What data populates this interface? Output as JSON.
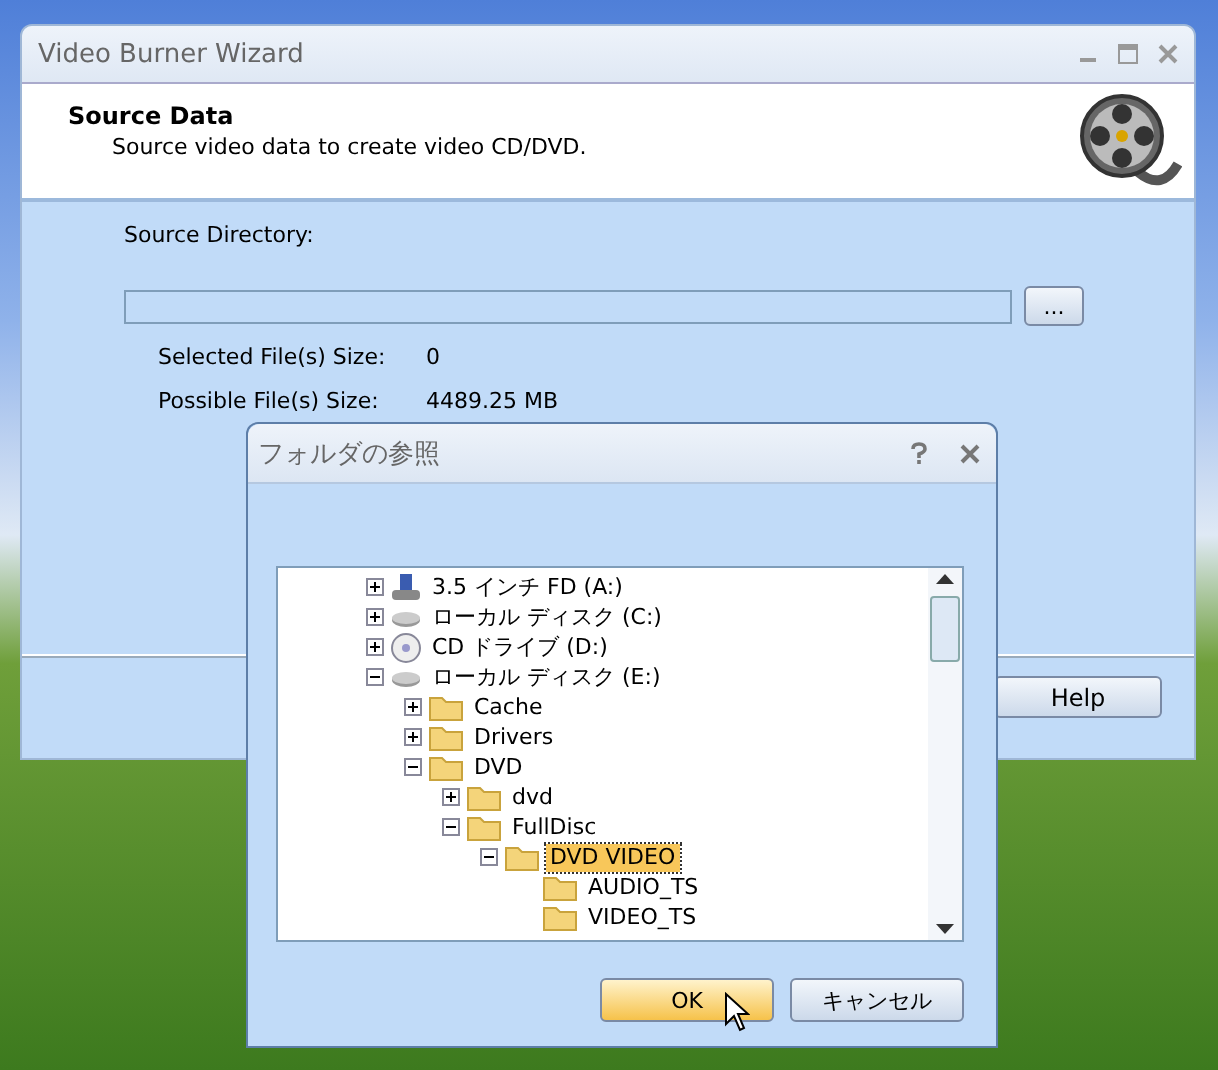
{
  "main_window": {
    "title": "Video Burner Wizard",
    "header": {
      "title": "Source Data",
      "subtitle": "Source video data to create video CD/DVD."
    },
    "source_directory": {
      "label": "Source Directory:",
      "browse_button": "..."
    },
    "fields": [
      {
        "label": "Selected File(s) Size:",
        "value": "0"
      },
      {
        "label": "Possible File(s) Size:",
        "value": "4489.25 MB"
      }
    ],
    "buttons": [
      "Help"
    ]
  },
  "folder_dialog": {
    "title": "フォルダの参照",
    "tree": [
      {
        "label": "3.5 インチ FD (A:)",
        "kind": "floppy",
        "expanded": false,
        "selected": false
      },
      {
        "label": "ローカル ディスク (C:)",
        "kind": "drive",
        "expanded": false,
        "selected": false
      },
      {
        "label": "CD ドライブ (D:)",
        "kind": "cd",
        "expanded": false,
        "selected": false
      },
      {
        "label": "ローカル ディスク (E:)",
        "kind": "drive",
        "expanded": true,
        "selected": false,
        "children": [
          {
            "label": "Cache",
            "kind": "folder",
            "expanded": false,
            "selected": false
          },
          {
            "label": "Drivers",
            "kind": "folder",
            "expanded": false,
            "selected": false
          },
          {
            "label": "DVD",
            "kind": "folder",
            "expanded": true,
            "selected": false,
            "children": [
              {
                "label": "dvd",
                "kind": "folder",
                "expanded": false,
                "selected": false
              },
              {
                "label": "FullDisc",
                "kind": "folder",
                "expanded": true,
                "selected": false,
                "children": [
                  {
                    "label": "DVD VIDEO",
                    "kind": "folder",
                    "expanded": true,
                    "selected": true,
                    "children": [
                      {
                        "label": "AUDIO_TS",
                        "kind": "folder",
                        "selected": false
                      },
                      {
                        "label": "VIDEO_TS",
                        "kind": "folder",
                        "selected": false
                      }
                    ]
                  }
                ]
              }
            ]
          }
        ]
      }
    ],
    "buttons": [
      {
        "label": "OK",
        "hovered": true
      },
      {
        "label": "キャンセル",
        "hovered": false
      }
    ]
  }
}
